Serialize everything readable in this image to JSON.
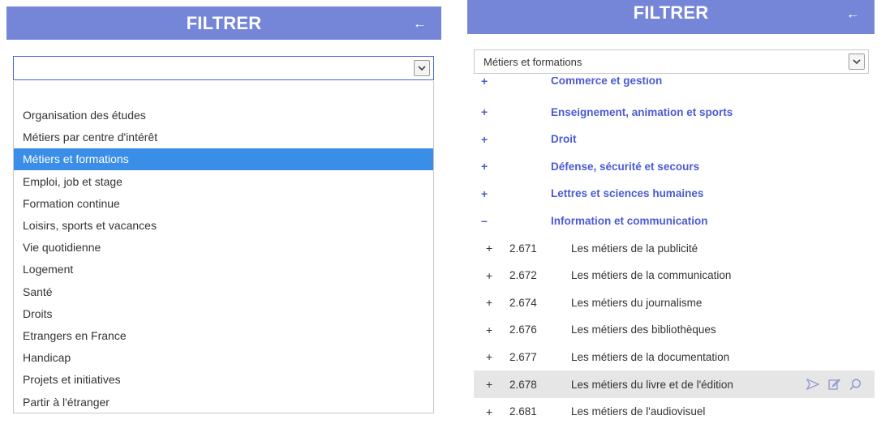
{
  "left": {
    "header": {
      "title": "FILTRER",
      "back_icon": "←"
    },
    "select": {
      "value": ""
    },
    "options": [
      "Organisation des études",
      "Métiers par centre d'intérêt",
      "Métiers et formations",
      "Emploi, job et stage",
      "Formation continue",
      "Loisirs, sports et vacances",
      "Vie quotidienne",
      "Logement",
      "Santé",
      "Droits",
      "Etrangers en France",
      "Handicap",
      "Projets et initiatives",
      "Partir à l'étranger"
    ],
    "selected_option": "Métiers et formations"
  },
  "right": {
    "header": {
      "title": "FILTRER",
      "back_icon": "←"
    },
    "select": {
      "value": "Métiers et formations"
    },
    "categories": [
      {
        "toggle": "+",
        "label": "Commerce et gestion",
        "partial": true
      },
      {
        "toggle": "+",
        "label": "Enseignement, animation et sports"
      },
      {
        "toggle": "+",
        "label": "Droit"
      },
      {
        "toggle": "+",
        "label": "Défense, sécurité et secours"
      },
      {
        "toggle": "+",
        "label": "Lettres et sciences humaines"
      },
      {
        "toggle": "–",
        "label": "Information et communication",
        "expanded": true
      }
    ],
    "subitems": [
      {
        "toggle": "+",
        "code": "2.671",
        "label": "Les métiers de la publicité"
      },
      {
        "toggle": "+",
        "code": "2.672",
        "label": "Les métiers de la communication"
      },
      {
        "toggle": "+",
        "code": "2.674",
        "label": "Les métiers du journalisme"
      },
      {
        "toggle": "+",
        "code": "2.676",
        "label": "Les métiers des bibliothèques"
      },
      {
        "toggle": "+",
        "code": "2.677",
        "label": "Les métiers de la documentation"
      },
      {
        "toggle": "+",
        "code": "2.678",
        "label": "Les métiers du livre et de l'édition",
        "hovered": true
      },
      {
        "toggle": "+",
        "code": "2.681",
        "label": "Les métiers de l'audiovisuel"
      }
    ],
    "row_actions": [
      "send-icon",
      "edit-icon",
      "search-icon"
    ]
  },
  "colors": {
    "header_bg": "#7585d8",
    "accent_text": "#4a5bd0",
    "selected_bg": "#3a8ee8",
    "hover_bg": "#e6e6e6"
  }
}
